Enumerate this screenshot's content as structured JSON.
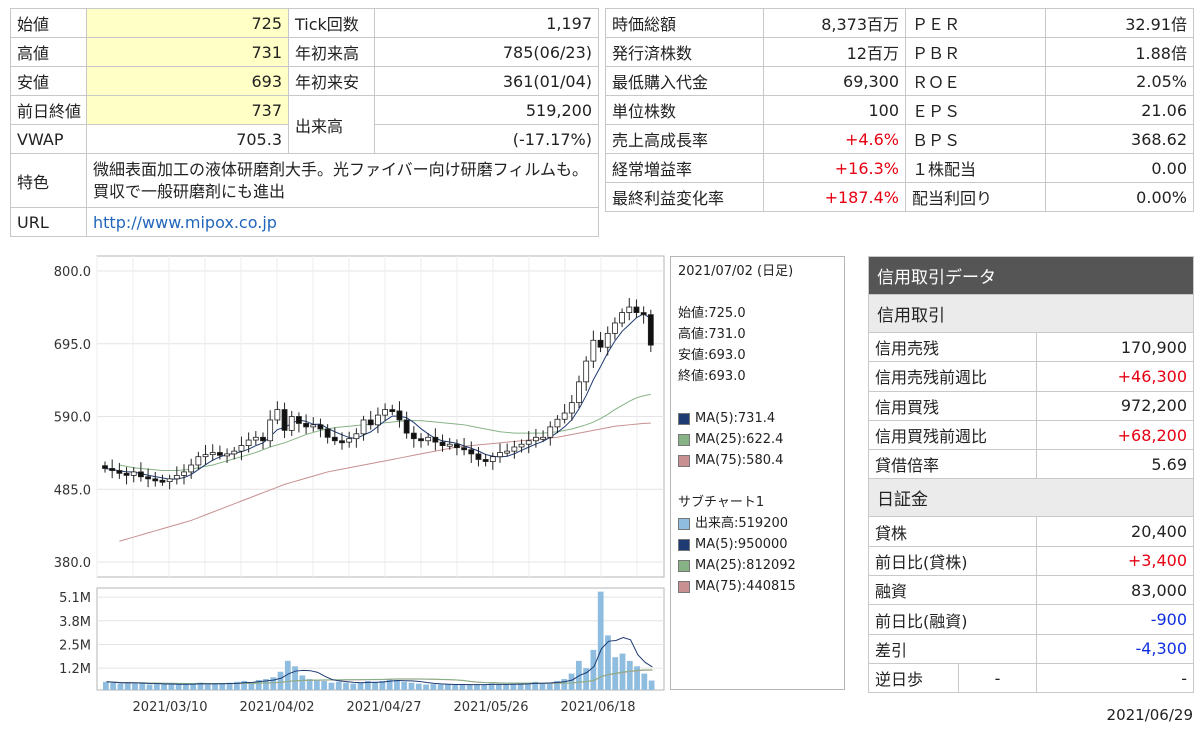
{
  "left_table": {
    "rows": [
      {
        "l1": "始値",
        "v1": "725",
        "l2": "Tick回数",
        "v2": "1,197"
      },
      {
        "l1": "高値",
        "v1": "731",
        "l2": "年初来高",
        "v2": "785(06/23)"
      },
      {
        "l1": "安値",
        "v1": "693",
        "l2": "年初来安",
        "v2": "361(01/04)"
      }
    ],
    "prev_close_label": "前日終値",
    "prev_close": "737",
    "vwap_label": "VWAP",
    "vwap": "705.3",
    "volume_label": "出来高",
    "volume": "519,200",
    "volume_change": "(-17.17%)",
    "feature_label": "特色",
    "feature": "微細表面加工の液体研磨剤大手。光ファイバー向け研磨フィルムも。買収で一般研磨剤にも進出",
    "url_label": "URL",
    "url": "http://www.mipox.co.jp"
  },
  "right_table": {
    "rows": [
      {
        "l1": "時価総額",
        "v1": "8,373百万",
        "c1": "",
        "l2": "ＰＥＲ",
        "v2": "32.91倍"
      },
      {
        "l1": "発行済株数",
        "v1": "12百万",
        "c1": "",
        "l2": "ＰＢＲ",
        "v2": "1.88倍"
      },
      {
        "l1": "最低購入代金",
        "v1": "69,300",
        "c1": "",
        "l2": "ＲＯＥ",
        "v2": "2.05%"
      },
      {
        "l1": "単位株数",
        "v1": "100",
        "c1": "",
        "l2": "ＥＰＳ",
        "v2": "21.06"
      },
      {
        "l1": "売上高成長率",
        "v1": "+4.6%",
        "c1": "red",
        "l2": "ＢＰＳ",
        "v2": "368.62"
      },
      {
        "l1": "経常増益率",
        "v1": "+16.3%",
        "c1": "red",
        "l2": "１株配当",
        "v2": "0.00"
      },
      {
        "l1": "最終利益変化率",
        "v1": "+187.4%",
        "c1": "red",
        "l2": "配当利回り",
        "v2": "0.00%"
      }
    ]
  },
  "legend": {
    "date": "2021/07/02 (日足)",
    "ohlc": [
      "始値:725.0",
      "高値:731.0",
      "安値:693.0",
      "終値:693.0"
    ],
    "ma": [
      {
        "label": "MA(5):731.4",
        "color": "#1f3b73"
      },
      {
        "label": "MA(25):622.4",
        "color": "#86b286"
      },
      {
        "label": "MA(75):580.4",
        "color": "#c89090"
      }
    ],
    "sub_title": "サブチャート1",
    "sub": [
      {
        "label": "出来高:519200",
        "color": "#8fbde0"
      },
      {
        "label": "MA(5):950000",
        "color": "#1f3b73"
      },
      {
        "label": "MA(25):812092",
        "color": "#86b286"
      },
      {
        "label": "MA(75):440815",
        "color": "#c89090"
      }
    ]
  },
  "credit": {
    "title": "信用取引データ",
    "section1": "信用取引",
    "rows1": [
      {
        "label": "信用売残",
        "value": "170,900",
        "color": ""
      },
      {
        "label": "信用売残前週比",
        "value": "+46,300",
        "color": "red"
      },
      {
        "label": "信用買残",
        "value": "972,200",
        "color": ""
      },
      {
        "label": "信用買残前週比",
        "value": "+68,200",
        "color": "red"
      },
      {
        "label": "貸借倍率",
        "value": "5.69",
        "color": ""
      }
    ],
    "section2": "日証金",
    "rows2": [
      {
        "label": "貸株",
        "value": "20,400",
        "color": ""
      },
      {
        "label": "前日比(貸株)",
        "value": "+3,400",
        "color": "red"
      },
      {
        "label": "融資",
        "value": "83,000",
        "color": ""
      },
      {
        "label": "前日比(融資)",
        "value": "-900",
        "color": "blue"
      },
      {
        "label": "差引",
        "value": "-4,300",
        "color": "blue"
      }
    ],
    "reverse_label": "逆日歩",
    "reverse_mid": "-",
    "reverse_value": "-",
    "date": "2021/06/29"
  },
  "chart_data": [
    {
      "type": "candlestick",
      "title": "",
      "y_ticks": [
        "800.0",
        "695.0",
        "590.0",
        "485.0",
        "380.0"
      ],
      "ylim": [
        380,
        800
      ],
      "x_ticks": [
        "2021/03/10",
        "2021/04/02",
        "2021/04/27",
        "2021/05/26",
        "2021/06/18"
      ],
      "points": 80,
      "close": [
        515,
        512,
        508,
        505,
        510,
        503,
        500,
        498,
        496,
        500,
        505,
        510,
        520,
        532,
        535,
        538,
        534,
        536,
        540,
        548,
        556,
        560,
        555,
        585,
        600,
        570,
        590,
        580,
        575,
        578,
        572,
        560,
        555,
        553,
        558,
        565,
        585,
        578,
        592,
        600,
        598,
        585,
        566,
        558,
        555,
        560,
        553,
        548,
        550,
        545,
        542,
        536,
        528,
        525,
        532,
        538,
        540,
        546,
        550,
        555,
        560,
        560,
        575,
        586,
        595,
        610,
        640,
        670,
        700,
        690,
        710,
        725,
        740,
        748,
        740,
        737,
        693
      ],
      "ma25": [
        520,
        518,
        516,
        515,
        514,
        513,
        512,
        512,
        512,
        513,
        514,
        516,
        518,
        520,
        523,
        526,
        529,
        532,
        535,
        538,
        542,
        546,
        549,
        552,
        556,
        560,
        564,
        567,
        570,
        572,
        574,
        575,
        576,
        577,
        578,
        579,
        580,
        581,
        582,
        583,
        584,
        584,
        584,
        583,
        582,
        581,
        580,
        579,
        578,
        576,
        574,
        572,
        570,
        568,
        567,
        566,
        566,
        566,
        566,
        566,
        567,
        568,
        570,
        572,
        575,
        578,
        582,
        587,
        593,
        600,
        606,
        612,
        617,
        620,
        622
      ],
      "ma75": [
        410,
        413,
        416,
        419,
        422,
        425,
        428,
        431,
        434,
        437,
        440,
        444,
        448,
        452,
        456,
        460,
        464,
        468,
        472,
        476,
        480,
        484,
        488,
        492,
        495,
        498,
        501,
        504,
        507,
        510,
        512,
        514,
        516,
        518,
        520,
        522,
        524,
        526,
        528,
        530,
        532,
        534,
        536,
        538,
        540,
        542,
        544,
        546,
        547,
        548,
        549,
        550,
        551,
        552,
        553,
        554,
        555,
        556,
        557,
        558,
        559,
        560,
        562,
        564,
        566,
        568,
        570,
        572,
        574,
        576,
        577,
        578,
        579,
        580,
        580.4
      ],
      "series": [
        {
          "name": "MA(5)"
        },
        {
          "name": "MA(25)"
        },
        {
          "name": "MA(75)"
        }
      ]
    },
    {
      "type": "bar",
      "title": "",
      "y_ticks": [
        "5.1M",
        "3.8M",
        "2.5M",
        "1.2M"
      ],
      "ylim": [
        0,
        5.6
      ],
      "volumes_m": [
        0.45,
        0.4,
        0.35,
        0.4,
        0.35,
        0.38,
        0.3,
        0.32,
        0.3,
        0.35,
        0.3,
        0.32,
        0.35,
        0.4,
        0.3,
        0.32,
        0.35,
        0.4,
        0.45,
        0.5,
        0.4,
        0.55,
        0.6,
        0.7,
        1.0,
        1.6,
        1.3,
        0.8,
        0.6,
        0.55,
        0.5,
        0.4,
        0.45,
        0.4,
        0.35,
        0.4,
        0.5,
        0.45,
        0.5,
        0.6,
        0.55,
        0.45,
        0.4,
        0.35,
        0.3,
        0.32,
        0.3,
        0.3,
        0.28,
        0.3,
        0.3,
        0.28,
        0.3,
        0.35,
        0.3,
        0.32,
        0.3,
        0.35,
        0.4,
        0.45,
        0.35,
        0.4,
        0.5,
        0.6,
        0.9,
        1.6,
        1.2,
        2.2,
        5.4,
        3.0,
        1.8,
        2.0,
        1.6,
        1.3,
        0.9,
        0.52
      ]
    }
  ]
}
